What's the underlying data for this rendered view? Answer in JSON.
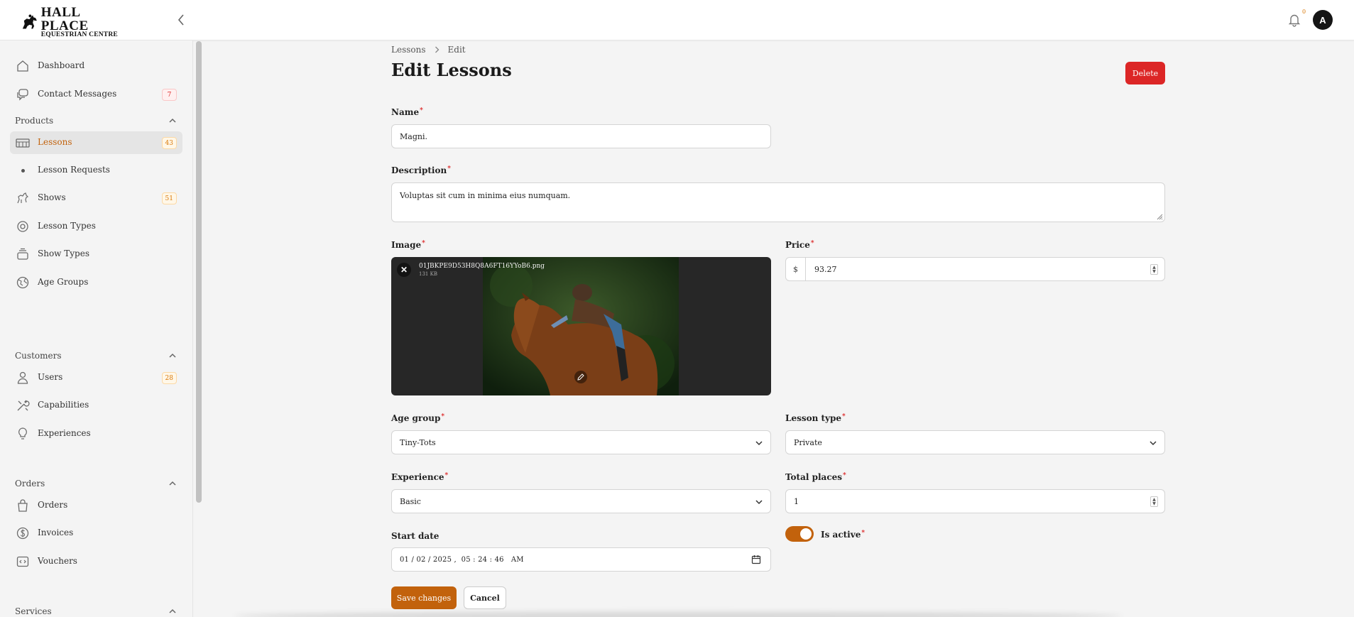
{
  "brand": {
    "line1": "HALL PLACE",
    "line2": "EQUESTRIAN CENTRE"
  },
  "header": {
    "notifications_count": "0",
    "avatar_initial": "A"
  },
  "sidebar": {
    "top_items": [
      {
        "label": "Dashboard",
        "icon": "home-icon"
      },
      {
        "label": "Contact Messages",
        "icon": "chat-icon",
        "badge": "7"
      }
    ],
    "groups": [
      {
        "label": "Products",
        "items": [
          {
            "label": "Lessons",
            "icon": "horse-fence-icon",
            "badge": "43",
            "active": true
          },
          {
            "label": "Lesson Requests",
            "icon": "dot-icon"
          },
          {
            "label": "Shows",
            "icon": "horse-icon",
            "badge": "51"
          },
          {
            "label": "Lesson Types",
            "icon": "badge-icon"
          },
          {
            "label": "Show Types",
            "icon": "stack-icon"
          },
          {
            "label": "Age Groups",
            "icon": "globe-icon"
          }
        ]
      },
      {
        "label": "Customers",
        "items": [
          {
            "label": "Users",
            "icon": "user-icon",
            "badge": "28"
          },
          {
            "label": "Capabilities",
            "icon": "tools-icon"
          },
          {
            "label": "Experiences",
            "icon": "lightbulb-icon"
          }
        ]
      },
      {
        "label": "Orders",
        "items": [
          {
            "label": "Orders",
            "icon": "bag-icon"
          },
          {
            "label": "Invoices",
            "icon": "dollar-icon"
          },
          {
            "label": "Vouchers",
            "icon": "code-icon"
          }
        ]
      },
      {
        "label": "Services",
        "items": []
      }
    ]
  },
  "page": {
    "breadcrumb": [
      "Lessons",
      "Edit"
    ],
    "title": "Edit Lessons",
    "delete_label": "Delete"
  },
  "form": {
    "name": {
      "label": "Name",
      "required": true,
      "value": "Magni."
    },
    "description": {
      "label": "Description",
      "required": true,
      "value": "Voluptas sit cum in minima eius numquam."
    },
    "image": {
      "label": "Image",
      "required": true,
      "file_name": "01JBKPE9D53H8Q8A6FT16YYoB6.png",
      "file_size": "131 KB"
    },
    "price": {
      "label": "Price",
      "required": true,
      "prefix": "$",
      "value": "93.27"
    },
    "age_group": {
      "label": "Age group",
      "required": true,
      "value": "Tiny-Tots"
    },
    "lesson_type": {
      "label": "Lesson type",
      "required": true,
      "value": "Private"
    },
    "experience": {
      "label": "Experience",
      "required": true,
      "value": "Basic"
    },
    "total_places": {
      "label": "Total places",
      "required": true,
      "value": "1"
    },
    "start_date": {
      "label": "Start date",
      "value": "01 / 02 / 2025 ,  05 : 24 : 46   AM"
    },
    "is_active": {
      "label": "Is active",
      "required": true,
      "value": true
    },
    "save_label": "Save changes",
    "cancel_label": "Cancel"
  },
  "colors": {
    "accent": "#c2620c",
    "danger": "#dc2626",
    "badge_bg": "#fff7e8"
  }
}
